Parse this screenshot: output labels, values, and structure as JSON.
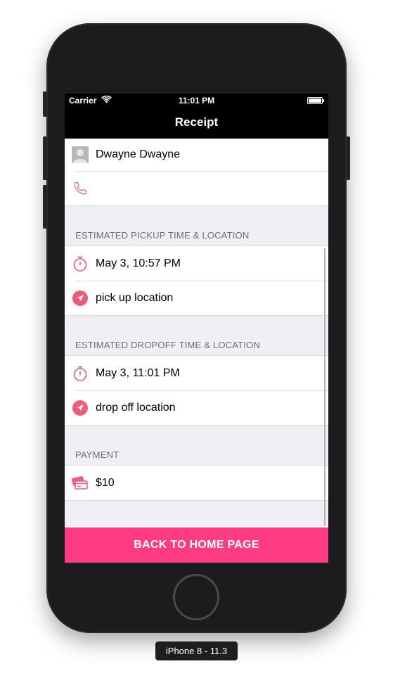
{
  "status_bar": {
    "carrier": "Carrier",
    "time": "11:01 PM"
  },
  "nav": {
    "title": "Receipt"
  },
  "customer": {
    "name": "Dwayne Dwayne",
    "phone": ""
  },
  "pickup": {
    "header": "ESTIMATED PICKUP TIME & LOCATION",
    "time": "May 3, 10:57 PM",
    "location": "pick up location"
  },
  "dropoff": {
    "header": "ESTIMATED DROPOFF TIME & LOCATION",
    "time": "May 3, 11:01 PM",
    "location": "drop off location"
  },
  "payment": {
    "header": "PAYMENT",
    "amount": "$10"
  },
  "actions": {
    "home_label": "BACK TO HOME PAGE"
  },
  "device_label": "iPhone 8 - 11.3",
  "colors": {
    "accent": "#ff3b84",
    "icon": "#f05a7e",
    "nav_bg": "#000000"
  }
}
